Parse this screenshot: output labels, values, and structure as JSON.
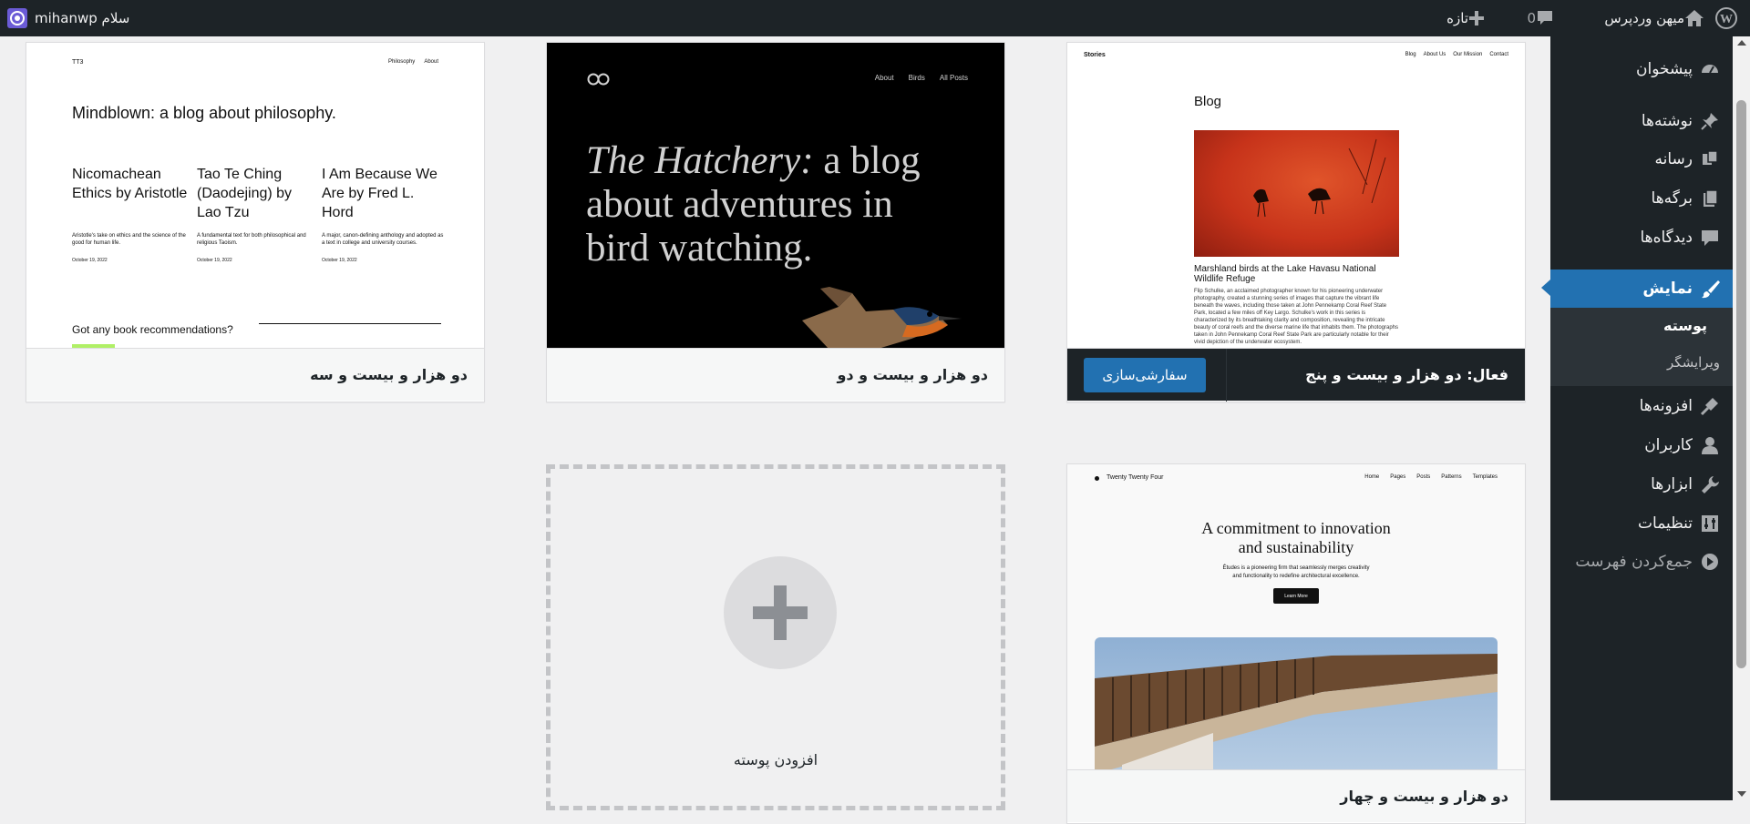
{
  "admin_bar": {
    "site_name": "میهن وردپرس",
    "comments_count": "0",
    "new_label": "تازه",
    "greeting": "سلام mihanwp",
    "icons": [
      "wordpress-logo-icon",
      "home-icon",
      "comment-icon",
      "plus-icon",
      "avatar"
    ]
  },
  "sidebar": {
    "items": [
      {
        "label": "پیشخوان",
        "icon": "dashboard-icon"
      },
      {
        "label": "نوشته‌ها",
        "icon": "pin-icon"
      },
      {
        "label": "رسانه",
        "icon": "media-icon"
      },
      {
        "label": "برگه‌ها",
        "icon": "pages-icon"
      },
      {
        "label": "دیدگاه‌ها",
        "icon": "comments-icon"
      },
      {
        "label": "نمایش",
        "icon": "appearance-brush-icon"
      },
      {
        "label": "افزونه‌ها",
        "icon": "plugins-icon"
      },
      {
        "label": "کاربران",
        "icon": "users-icon"
      },
      {
        "label": "ابزارها",
        "icon": "tools-icon"
      },
      {
        "label": "تنظیمات",
        "icon": "settings-icon"
      },
      {
        "label": "جمع‌کردن فهرست",
        "icon": "collapse-icon"
      }
    ],
    "submenu": [
      {
        "label": "پوسته"
      },
      {
        "label": "ویرایشگر"
      }
    ]
  },
  "themes": {
    "tt3": {
      "name": "دو هزار و بیست و سه",
      "preview": {
        "logo": "TT3",
        "nav": [
          "Philosophy",
          "About"
        ],
        "headline": "Mindblown: a blog about philosophy.",
        "posts": [
          {
            "title": "Nicomachean Ethics by Aristotle",
            "excerpt": "Aristotle's take on ethics and the science of the good for human life.",
            "date": "October 19, 2022"
          },
          {
            "title": "Tao Te Ching (Daodejing) by Lao Tzu",
            "excerpt": "A fundamental text for both philosophical and religious Taoism.",
            "date": "October 19, 2022"
          },
          {
            "title": "I Am Because We Are by Fred L. Hord",
            "excerpt": "A major, canon-defining anthology and adopted as a text in college and university courses.",
            "date": "October 19, 2022"
          }
        ],
        "footer_text": "Got any book recommendations?",
        "accent": "#b0f066"
      }
    },
    "tt2": {
      "name": "دو هزار و بیست و دو",
      "preview": {
        "nav": [
          "About",
          "Birds",
          "All Posts"
        ],
        "headline_italic": "The Hatchery:",
        "headline_rest": " a blog about adventures in bird watching."
      }
    },
    "tt5": {
      "active_prefix": "فعال:",
      "name": "دو هزار و بیست و پنج",
      "customize_label": "سفارشی‌سازی",
      "preview": {
        "site_title": "Stories",
        "nav": [
          "Blog",
          "About Us",
          "Our Mission",
          "Contact"
        ],
        "heading": "Blog",
        "post_title": "Marshland birds at the Lake Havasu National Wildlife Refuge",
        "post_excerpt": "Flip Schulke, an acclaimed photographer known for his pioneering underwater photography, created a stunning series of images that capture the vibrant life beneath the waves, including those taken at John Pennekamp Coral Reef State Park, located a few miles off Key Largo. Schulke's work in this series is characterized by its breathtaking clarity and composition, revealing the intricate beauty of coral reefs and the diverse marine life that inhabits them. The photographs taken in John Pennekamp Coral Reef State Park are particularly notable for their vivid depiction of the underwater ecosystem."
      }
    },
    "tt4": {
      "name": "دو هزار و بیست و چهار",
      "preview": {
        "site_title": "Twenty Twenty Four",
        "nav": [
          "Home",
          "Pages",
          "Posts",
          "Patterns",
          "Templates"
        ],
        "headline": "A commitment to innovation and sustainability",
        "subtext": "Études is a pioneering firm that seamlessly merges creativity and functionality to redefine architectural excellence.",
        "button": "Learn More"
      }
    }
  },
  "add_new": {
    "label": "افزودن پوسته"
  },
  "colors": {
    "admin_dark": "#1d2327",
    "accent_blue": "#2271b1",
    "background": "#f0f0f1"
  }
}
